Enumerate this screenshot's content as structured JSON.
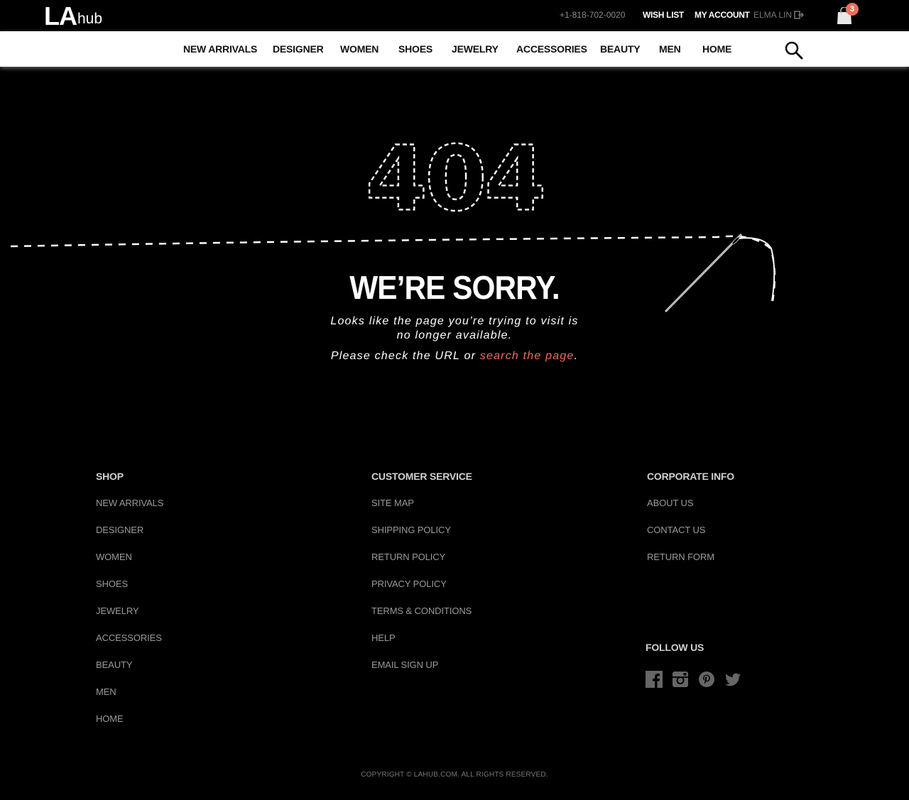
{
  "header": {
    "logo_la": "LA",
    "logo_hub": "hub",
    "phone": "+1-818-702-0020",
    "wish_list": "WISH LIST",
    "my_account": "MY ACCOUNT",
    "user_name": "ELMA LIN",
    "cart_count": "3"
  },
  "nav": {
    "items": [
      "NEW ARRIVALS",
      "DESIGNER",
      "WOMEN",
      "SHOES",
      "JEWELRY",
      "ACCESSORIES",
      "BEAUTY",
      "MEN",
      "HOME"
    ]
  },
  "error": {
    "code": "404",
    "heading": "WE’RE SORRY.",
    "line1": "Looks like the page you’re trying to visit is",
    "line2": "no longer available.",
    "line3_prefix": "Please check the URL or ",
    "line3_link": "search the page",
    "line3_suffix": "."
  },
  "footer": {
    "shop": {
      "title": "SHOP",
      "links": [
        "NEW ARRIVALS",
        "DESIGNER",
        "WOMEN",
        "SHOES",
        "JEWELRY",
        "ACCESSORIES",
        "BEAUTY",
        "MEN",
        "HOME"
      ]
    },
    "customer_service": {
      "title": "CUSTOMER SERVICE",
      "links": [
        "SITE MAP",
        "SHIPPING POLICY",
        "RETURN POLICY",
        "PRIVACY POLICY",
        "TERMS & CONDITIONS",
        "HELP",
        "EMAIL SIGN UP"
      ]
    },
    "corporate": {
      "title": "CORPORATE INFO",
      "links": [
        "ABOUT US",
        "CONTACT US",
        "RETURN FORM"
      ]
    },
    "follow_us": "FOLLOW US",
    "social_icons": [
      "facebook-icon",
      "instagram-icon",
      "pinterest-icon",
      "twitter-icon"
    ],
    "copyright": "COPYRIGHT © LAHUB.COM. ALL RIGHTS RESERVED."
  },
  "colors": {
    "accent": "#f06d5a",
    "background": "#000000",
    "nav_background": "#ffffff"
  }
}
